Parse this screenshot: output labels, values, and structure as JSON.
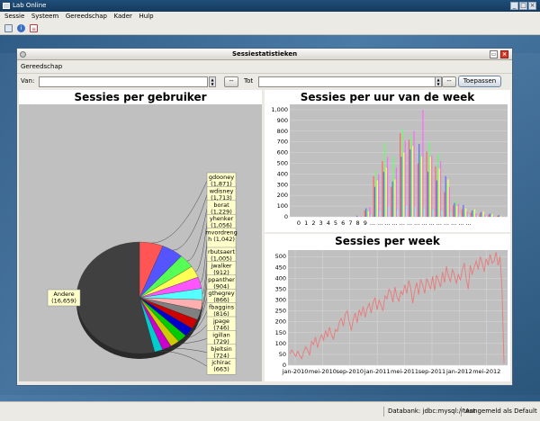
{
  "app": {
    "title": "Lab Online",
    "menu": [
      "Sessie",
      "Systeem",
      "Gereedschap",
      "Kader",
      "Hulp"
    ],
    "toolbar_icons": [
      "home-icon",
      "info-icon",
      "document-icon"
    ]
  },
  "window": {
    "title": "Sessiestatistieken",
    "menu": [
      "Gereedschap"
    ],
    "filter": {
      "from_label": "Van:",
      "from_value": "",
      "to_label": "Tot",
      "to_value": "",
      "minus_label": "--",
      "apply_label": "Toepassen"
    }
  },
  "statusbar": {
    "database": "Databank: jdbc:mysql://test",
    "user": "Aangemeld als Default"
  },
  "colors": {
    "pie_large": "#404040",
    "line": "#e87a7a",
    "plot_bg": "#c0c0c0",
    "label_bg": "#ffffcc"
  },
  "chart_data": [
    {
      "type": "pie",
      "title": "Sessies per gebruiker",
      "slices": [
        {
          "label": "gdooney (1,871)",
          "value": 1871,
          "color": "#ff5555"
        },
        {
          "label": "wdisney (1,713)",
          "value": 1713,
          "color": "#5555ff"
        },
        {
          "label": "borat (1,229)",
          "value": 1229,
          "color": "#55ff55"
        },
        {
          "label": "yhenker (1,056)",
          "value": 1056,
          "color": "#ffff55"
        },
        {
          "label": "mvordreng h (1,042)",
          "value": 1042,
          "color": "#ff55ff"
        },
        {
          "label": "rbutsaert (1,005)",
          "value": 1005,
          "color": "#55ffff"
        },
        {
          "label": "jwalker (912)",
          "value": 912,
          "color": "#ffafaf"
        },
        {
          "label": "ppanther (904)",
          "value": 904,
          "color": "#808080"
        },
        {
          "label": "gthegrey (866)",
          "value": 866,
          "color": "#cc0000"
        },
        {
          "label": "fbaggins (816)",
          "value": 816,
          "color": "#0000cc"
        },
        {
          "label": "jpage (746)",
          "value": 746,
          "color": "#00cc00"
        },
        {
          "label": "igillan (729)",
          "value": 729,
          "color": "#cccc00"
        },
        {
          "label": "bjeltsin (724)",
          "value": 724,
          "color": "#cc00cc"
        },
        {
          "label": "jchirac (663)",
          "value": 663,
          "color": "#00cccc"
        },
        {
          "label": "Andere (16,659)",
          "value": 16659,
          "color": "#404040"
        }
      ]
    },
    {
      "type": "bar",
      "title": "Sessies per uur van de week",
      "ylim": [
        0,
        1050
      ],
      "yticks": [
        0,
        100,
        200,
        300,
        400,
        500,
        600,
        700,
        800,
        900,
        "1,000"
      ],
      "xticks": [
        "0",
        "1",
        "2",
        "3",
        "4",
        "5",
        "6",
        "7",
        "8",
        "9",
        "...",
        "...",
        "...",
        "...",
        "...",
        "...",
        "...",
        "...",
        "...",
        "...",
        "...",
        "...",
        "...",
        "..."
      ],
      "series_colors": [
        "#ff6666",
        "#6666ff",
        "#66ff66",
        "#ffff66",
        "#ff66ff",
        "#66ffff",
        "#ffaaaa"
      ],
      "hour_values": [
        [
          0,
          0,
          0,
          0,
          0,
          0,
          0
        ],
        [
          0,
          0,
          0,
          0,
          0,
          0,
          0
        ],
        [
          0,
          0,
          0,
          0,
          0,
          0,
          0
        ],
        [
          0,
          0,
          0,
          0,
          0,
          0,
          0
        ],
        [
          0,
          0,
          0,
          0,
          0,
          0,
          0
        ],
        [
          0,
          0,
          0,
          0,
          0,
          0,
          0
        ],
        [
          0,
          0,
          0,
          0,
          0,
          0,
          0
        ],
        [
          0,
          10,
          0,
          0,
          5,
          0,
          0
        ],
        [
          60,
          80,
          70,
          50,
          90,
          20,
          10
        ],
        [
          380,
          280,
          430,
          340,
          400,
          60,
          40
        ],
        [
          520,
          420,
          690,
          460,
          560,
          90,
          60
        ],
        [
          280,
          330,
          560,
          350,
          460,
          70,
          50
        ],
        [
          780,
          560,
          820,
          600,
          710,
          100,
          70
        ],
        [
          720,
          630,
          760,
          660,
          800,
          90,
          60
        ],
        [
          500,
          680,
          590,
          560,
          1000,
          80,
          50
        ],
        [
          610,
          420,
          700,
          560,
          570,
          70,
          50
        ],
        [
          470,
          340,
          590,
          450,
          520,
          60,
          40
        ],
        [
          230,
          380,
          300,
          350,
          280,
          40,
          30
        ],
        [
          110,
          130,
          150,
          100,
          120,
          30,
          20
        ],
        [
          70,
          110,
          60,
          80,
          50,
          20,
          15
        ],
        [
          40,
          60,
          50,
          70,
          30,
          15,
          10
        ],
        [
          30,
          45,
          20,
          50,
          20,
          10,
          10
        ],
        [
          20,
          30,
          15,
          25,
          10,
          5,
          5
        ],
        [
          10,
          15,
          10,
          10,
          5,
          0,
          0
        ]
      ]
    },
    {
      "type": "line",
      "title": "Sessies per week",
      "ylim": [
        0,
        530
      ],
      "yticks": [
        0,
        50,
        100,
        150,
        200,
        250,
        300,
        350,
        400,
        450,
        500
      ],
      "xticks": [
        "jan-2010",
        "mei-2010",
        "sep-2010",
        "jan-2011",
        "mei-2011",
        "sep-2011",
        "jan-2012",
        "mei-2012"
      ],
      "x_start": "jan-2010",
      "x_end": "jul-2012",
      "values": [
        50,
        70,
        55,
        40,
        65,
        45,
        30,
        60,
        85,
        70,
        45,
        110,
        95,
        130,
        80,
        120,
        140,
        115,
        160,
        130,
        175,
        140,
        120,
        165,
        155,
        200,
        215,
        180,
        235,
        250,
        200,
        160,
        210,
        240,
        195,
        255,
        230,
        270,
        220,
        260,
        285,
        240,
        290,
        310,
        255,
        300,
        275,
        250,
        320,
        305,
        350,
        335,
        290,
        360,
        315,
        295,
        340,
        325,
        370,
        330,
        390,
        355,
        285,
        345,
        380,
        325,
        395,
        370,
        330,
        400,
        375,
        350,
        410,
        345,
        415,
        390,
        360,
        430,
        380,
        455,
        410,
        385,
        440,
        415,
        375,
        420,
        390,
        440,
        470,
        395,
        350,
        460,
        420,
        450,
        480,
        440,
        500,
        470,
        430,
        490,
        460,
        510,
        470,
        480,
        520,
        460,
        500,
        350,
        10
      ]
    }
  ]
}
